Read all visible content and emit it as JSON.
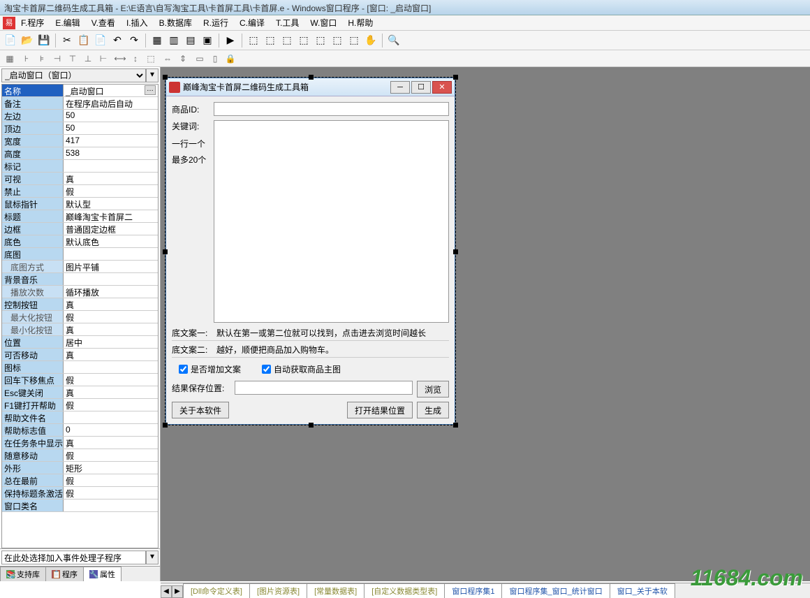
{
  "title_bar": "淘宝卡首屏二维码生成工具箱 - E:\\E语言\\自写淘宝工具\\卡首屏工具\\卡首屏.e - Windows窗口程序 - [窗口: _启动窗口]",
  "menu": [
    "F.程序",
    "E.编辑",
    "V.查看",
    "I.插入",
    "B.数据库",
    "R.运行",
    "C.编译",
    "T.工具",
    "W.窗口",
    "H.帮助"
  ],
  "combo_selected": "_启动窗口（窗口）",
  "properties": [
    {
      "label": "名称",
      "value": "_启动窗口",
      "selected": true,
      "dots": true
    },
    {
      "label": "备注",
      "value": "在程序启动后自动"
    },
    {
      "label": "左边",
      "value": "50"
    },
    {
      "label": "顶边",
      "value": "50"
    },
    {
      "label": "宽度",
      "value": "417"
    },
    {
      "label": "高度",
      "value": "538"
    },
    {
      "label": "标记",
      "value": ""
    },
    {
      "label": "可视",
      "value": "真"
    },
    {
      "label": "禁止",
      "value": "假"
    },
    {
      "label": "鼠标指针",
      "value": "默认型"
    },
    {
      "label": "标题",
      "value": "巅峰淘宝卡首屏二"
    },
    {
      "label": "边框",
      "value": "普通固定边框"
    },
    {
      "label": "底色",
      "value": "默认底色"
    },
    {
      "label": "底图",
      "value": ""
    },
    {
      "label": "底图方式",
      "value": "图片平铺",
      "sub": true
    },
    {
      "label": "背景音乐",
      "value": ""
    },
    {
      "label": "播放次数",
      "value": "循环播放",
      "sub": true
    },
    {
      "label": "控制按钮",
      "value": "真"
    },
    {
      "label": "最大化按钮",
      "value": "假",
      "sub": true
    },
    {
      "label": "最小化按钮",
      "value": "真",
      "sub": true
    },
    {
      "label": "位置",
      "value": "居中"
    },
    {
      "label": "可否移动",
      "value": "真"
    },
    {
      "label": "图标",
      "value": ""
    },
    {
      "label": "回车下移焦点",
      "value": "假"
    },
    {
      "label": "Esc键关闭",
      "value": "真"
    },
    {
      "label": "F1键打开帮助",
      "value": "假"
    },
    {
      "label": "帮助文件名",
      "value": ""
    },
    {
      "label": "帮助标志值",
      "value": "0"
    },
    {
      "label": "在任务条中显示",
      "value": "真"
    },
    {
      "label": "随意移动",
      "value": "假"
    },
    {
      "label": "外形",
      "value": "矩形"
    },
    {
      "label": "总在最前",
      "value": "假"
    },
    {
      "label": "保持标题条激活",
      "value": "假"
    },
    {
      "label": "窗口类名",
      "value": ""
    }
  ],
  "hint": "在此处选择加入事件处理子程序",
  "left_tabs": [
    "支持库",
    "程序",
    "属性"
  ],
  "dialog": {
    "title": "巅峰淘宝卡首屏二维码生成工具箱",
    "product_id_label": "商品ID:",
    "keyword_label": "关键词:",
    "keyword_hint1": "一行一个",
    "keyword_hint2": "最多20个",
    "note1_label": "底文案一:",
    "note1_text": "默认在第一或第二位就可以找到，点击进去浏览时间越长",
    "note2_label": "底文案二:",
    "note2_text": "越好，顺便把商品加入购物车。",
    "chk1": "是否增加文案",
    "chk2": "自动获取商品主图",
    "save_label": "结果保存位置:",
    "browse": "浏览",
    "about": "关于本软件",
    "open_result": "打开结果位置",
    "generate": "生成"
  },
  "doc_tabs": [
    "[Dll命令定义表]",
    "[图片资源表]",
    "[常量数据表]",
    "[自定义数据类型表]",
    "窗口程序集1",
    "窗口程序集_窗口_统计窗口",
    "窗口_关于本软"
  ],
  "watermark": "11684.com"
}
